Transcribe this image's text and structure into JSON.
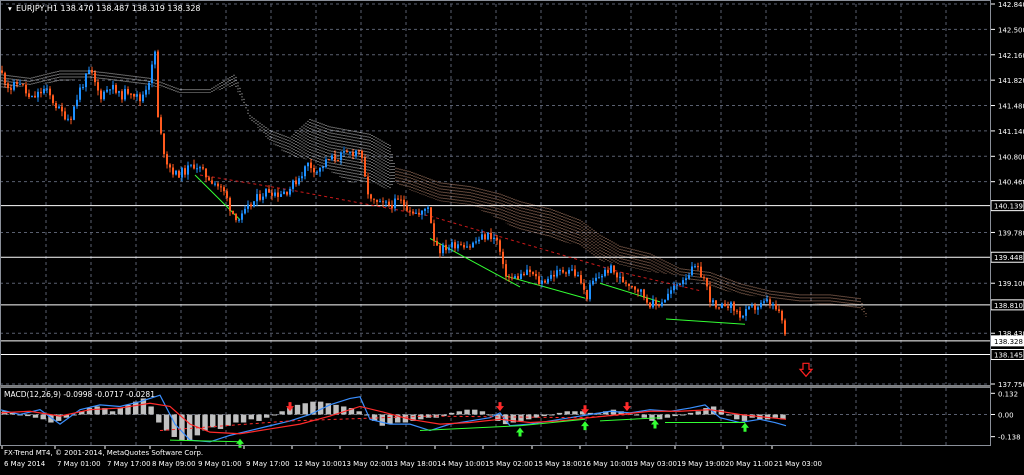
{
  "window": {
    "title": "EURJPY,H1  138.470 138.487 138.319 138.328",
    "copyright": "FX-Trend MT4, © 2001-2014, MetaQuotes Software Corp."
  },
  "colors": {
    "background": "#000000",
    "grid": "#5a6070",
    "bull": "#1e90ff",
    "bear": "#ff5a1e",
    "wick": "#c8c8c8",
    "cloud": "#ffffff",
    "cloud_bear": "#f0b090",
    "trendline": "#33ff33",
    "dashed_line": "#ff2020",
    "level_line": "#ffffff",
    "macd_hist": "#c0c0c0",
    "macd_main": "#3a8fff",
    "macd_signal": "#ff2a2a",
    "arrow_up": "#33ff33",
    "arrow_down": "#ff2a2a",
    "sell_arrow": "#ff2020"
  },
  "chart_data": {
    "type": "candlestick",
    "symbol": "EURJPY",
    "timeframe": "H1",
    "ohlc_header": {
      "open": 138.47,
      "high": 138.487,
      "low": 138.319,
      "close": 138.328
    },
    "y_ticks": [
      "142.840",
      "142.500",
      "142.160",
      "141.820",
      "141.480",
      "141.140",
      "140.800",
      "140.460",
      "139.780",
      "139.100",
      "138.430",
      "137.750"
    ],
    "y_tick_values": [
      142.84,
      142.5,
      142.16,
      141.82,
      141.48,
      141.14,
      140.8,
      140.46,
      139.78,
      139.1,
      138.43,
      137.75
    ],
    "ylim": [
      137.75,
      142.84
    ],
    "x_ticks": [
      "6 May 2014",
      "7 May 01:00",
      "7 May 17:00",
      "8 May 09:00",
      "9 May 01:00",
      "9 May 17:00",
      "12 May 10:00",
      "13 May 02:00",
      "13 May 18:00",
      "14 May 10:00",
      "15 May 02:00",
      "15 May 18:00",
      "16 May 10:00",
      "19 May 03:00",
      "19 May 19:00",
      "20 May 11:00",
      "21 May 03:00"
    ],
    "levels": [
      {
        "label": "140.139",
        "value": 140.139
      },
      {
        "label": "139.448",
        "value": 139.448
      },
      {
        "label": "138.810",
        "value": 138.81
      },
      {
        "label": "138.328",
        "value": 138.328,
        "current": true
      },
      {
        "label": "138.145",
        "value": 138.145
      }
    ],
    "price_path": [
      [
        0,
        141.95
      ],
      [
        10,
        141.7
      ],
      [
        20,
        141.8
      ],
      [
        30,
        141.55
      ],
      [
        45,
        141.7
      ],
      [
        60,
        141.4
      ],
      [
        70,
        141.3
      ],
      [
        80,
        141.7
      ],
      [
        90,
        141.95
      ],
      [
        100,
        141.6
      ],
      [
        110,
        141.75
      ],
      [
        120,
        141.6
      ],
      [
        130,
        141.7
      ],
      [
        140,
        141.55
      ],
      [
        150,
        141.85
      ],
      [
        155,
        142.2
      ],
      [
        158,
        141.3
      ],
      [
        162,
        141.0
      ],
      [
        166,
        140.75
      ],
      [
        175,
        140.55
      ],
      [
        185,
        140.6
      ],
      [
        195,
        140.7
      ],
      [
        205,
        140.55
      ],
      [
        215,
        140.45
      ],
      [
        225,
        140.3
      ],
      [
        232,
        140.05
      ],
      [
        240,
        139.95
      ],
      [
        248,
        140.1
      ],
      [
        258,
        140.25
      ],
      [
        268,
        140.35
      ],
      [
        278,
        140.3
      ],
      [
        288,
        140.35
      ],
      [
        298,
        140.5
      ],
      [
        308,
        140.7
      ],
      [
        318,
        140.6
      ],
      [
        328,
        140.75
      ],
      [
        340,
        140.8
      ],
      [
        352,
        140.85
      ],
      [
        360,
        140.9
      ],
      [
        364,
        140.55
      ],
      [
        370,
        140.2
      ],
      [
        380,
        140.15
      ],
      [
        390,
        140.15
      ],
      [
        400,
        140.2
      ],
      [
        410,
        140.1
      ],
      [
        420,
        140.0
      ],
      [
        428,
        140.15
      ],
      [
        434,
        139.7
      ],
      [
        440,
        139.55
      ],
      [
        450,
        139.6
      ],
      [
        460,
        139.65
      ],
      [
        470,
        139.6
      ],
      [
        480,
        139.7
      ],
      [
        490,
        139.75
      ],
      [
        498,
        139.65
      ],
      [
        503,
        139.3
      ],
      [
        510,
        139.15
      ],
      [
        520,
        139.2
      ],
      [
        530,
        139.25
      ],
      [
        540,
        139.1
      ],
      [
        550,
        139.2
      ],
      [
        560,
        139.25
      ],
      [
        570,
        139.3
      ],
      [
        580,
        139.15
      ],
      [
        586,
        138.9
      ],
      [
        592,
        139.1
      ],
      [
        600,
        139.2
      ],
      [
        610,
        139.3
      ],
      [
        620,
        139.15
      ],
      [
        630,
        139.1
      ],
      [
        640,
        139.0
      ],
      [
        648,
        138.85
      ],
      [
        656,
        138.8
      ],
      [
        665,
        138.9
      ],
      [
        675,
        139.05
      ],
      [
        685,
        139.2
      ],
      [
        695,
        139.3
      ],
      [
        703,
        139.2
      ],
      [
        710,
        138.9
      ],
      [
        718,
        138.7
      ],
      [
        726,
        138.85
      ],
      [
        734,
        138.75
      ],
      [
        742,
        138.65
      ],
      [
        750,
        138.75
      ],
      [
        760,
        138.8
      ],
      [
        768,
        138.85
      ],
      [
        776,
        138.75
      ],
      [
        782,
        138.6
      ],
      [
        786,
        138.33
      ]
    ],
    "cloud_path": [
      [
        0,
        141.9,
        141.7
      ],
      [
        30,
        141.85,
        141.75
      ],
      [
        60,
        141.95,
        141.8
      ],
      [
        90,
        141.95,
        141.85
      ],
      [
        120,
        141.9,
        141.8
      ],
      [
        150,
        141.85,
        141.75
      ],
      [
        180,
        141.7,
        141.65
      ],
      [
        210,
        141.7,
        141.65
      ],
      [
        235,
        141.9,
        141.75
      ],
      [
        250,
        141.35,
        141.3
      ],
      [
        270,
        141.15,
        141.0
      ],
      [
        290,
        141.05,
        140.8
      ],
      [
        310,
        141.3,
        140.75
      ],
      [
        330,
        141.2,
        140.6
      ],
      [
        350,
        141.15,
        140.45
      ],
      [
        370,
        141.1,
        140.45
      ],
      [
        390,
        140.95,
        140.35
      ],
      [
        395,
        140.65,
        140.45
      ],
      [
        410,
        140.6,
        140.35
      ],
      [
        440,
        140.45,
        140.2
      ],
      [
        470,
        140.4,
        140.15
      ],
      [
        500,
        140.3,
        139.95
      ],
      [
        520,
        140.2,
        139.8
      ],
      [
        550,
        140.1,
        139.7
      ],
      [
        580,
        139.95,
        139.6
      ],
      [
        600,
        139.75,
        139.4
      ],
      [
        620,
        139.6,
        139.35
      ],
      [
        650,
        139.5,
        139.25
      ],
      [
        680,
        139.3,
        139.2
      ],
      [
        710,
        139.25,
        139.05
      ],
      [
        740,
        139.1,
        138.95
      ],
      [
        770,
        139.0,
        138.9
      ],
      [
        800,
        138.95,
        138.85
      ],
      [
        830,
        138.95,
        138.8
      ],
      [
        860,
        138.9,
        138.75
      ],
      [
        866,
        138.7,
        138.65
      ]
    ],
    "trendlines": [
      [
        [
          195,
          140.55
        ],
        [
          240,
          139.95
        ]
      ],
      [
        [
          430,
          139.7
        ],
        [
          520,
          139.05
        ]
      ],
      [
        [
          505,
          139.2
        ],
        [
          585,
          138.9
        ]
      ],
      [
        [
          600,
          139.1
        ],
        [
          660,
          138.85
        ]
      ],
      [
        [
          666,
          138.62
        ],
        [
          745,
          138.55
        ]
      ]
    ],
    "dashed_trend": [
      [
        200,
        140.55
      ],
      [
        290,
        140.35
      ],
      [
        430,
        140.0
      ],
      [
        620,
        139.25
      ],
      [
        700,
        139.0
      ]
    ],
    "sell_signal": {
      "x": 806,
      "value": 137.92
    },
    "macd": {
      "label": "MACD(12,26,9) -0.0998 -0.0717 -0.0281",
      "y_ticks": [
        "0.132",
        "0.00",
        "-0.138"
      ],
      "y_tick_values": [
        0.132,
        0.0,
        -0.138
      ],
      "ylim": [
        -0.19,
        0.165
      ],
      "histogram": [
        0.02,
        0.01,
        0.0,
        -0.01,
        -0.02,
        -0.03,
        -0.05,
        -0.04,
        -0.02,
        0.0,
        0.02,
        0.04,
        0.05,
        0.04,
        0.02,
        0.04,
        0.06,
        0.08,
        0.1,
        0.05,
        -0.05,
        -0.1,
        -0.14,
        -0.16,
        -0.16,
        -0.13,
        -0.1,
        -0.08,
        -0.09,
        -0.07,
        -0.05,
        -0.05,
        -0.03,
        -0.04,
        -0.02,
        0.0,
        0.02,
        0.04,
        0.06,
        0.07,
        0.08,
        0.08,
        0.07,
        0.06,
        0.05,
        0.04,
        0.02,
        0.0,
        -0.04,
        -0.07,
        -0.06,
        -0.05,
        -0.05,
        -0.04,
        -0.03,
        -0.02,
        -0.02,
        -0.01,
        0.01,
        0.02,
        0.03,
        0.03,
        0.02,
        0.0,
        -0.04,
        -0.06,
        -0.05,
        -0.04,
        -0.03,
        -0.02,
        -0.01,
        0.0,
        0.01,
        0.02,
        0.02,
        0.02,
        0.01,
        0.01,
        0.02,
        0.03,
        0.02,
        0.01,
        0.0,
        -0.02,
        -0.04,
        -0.03,
        -0.02,
        -0.01,
        0.0,
        0.01,
        0.02,
        0.04,
        0.05,
        0.03,
        0.0,
        -0.03,
        -0.04,
        -0.02,
        -0.03,
        -0.03,
        -0.02,
        -0.03
      ],
      "main_line": [
        [
          0,
          0.03
        ],
        [
          20,
          0.0
        ],
        [
          40,
          0.03
        ],
        [
          60,
          -0.06
        ],
        [
          80,
          0.03
        ],
        [
          100,
          0.06
        ],
        [
          120,
          0.05
        ],
        [
          140,
          0.08
        ],
        [
          160,
          0.12
        ],
        [
          175,
          -0.06
        ],
        [
          190,
          -0.16
        ],
        [
          210,
          -0.17
        ],
        [
          230,
          -0.13
        ],
        [
          250,
          -0.1
        ],
        [
          270,
          -0.07
        ],
        [
          290,
          -0.04
        ],
        [
          310,
          0.0
        ],
        [
          330,
          0.06
        ],
        [
          350,
          0.1
        ],
        [
          360,
          0.11
        ],
        [
          370,
          -0.03
        ],
        [
          390,
          -0.06
        ],
        [
          410,
          -0.06
        ],
        [
          430,
          -0.1
        ],
        [
          450,
          -0.06
        ],
        [
          470,
          -0.04
        ],
        [
          490,
          -0.02
        ],
        [
          500,
          0.01
        ],
        [
          510,
          -0.07
        ],
        [
          530,
          -0.06
        ],
        [
          550,
          -0.04
        ],
        [
          570,
          -0.02
        ],
        [
          590,
          0.0
        ],
        [
          610,
          0.02
        ],
        [
          630,
          0.01
        ],
        [
          650,
          0.03
        ],
        [
          670,
          0.02
        ],
        [
          690,
          0.04
        ],
        [
          705,
          0.06
        ],
        [
          720,
          -0.02
        ],
        [
          740,
          -0.05
        ],
        [
          760,
          -0.03
        ],
        [
          775,
          -0.05
        ],
        [
          786,
          -0.07
        ]
      ],
      "signal_line": [
        [
          0,
          0.01
        ],
        [
          30,
          0.02
        ],
        [
          60,
          -0.01
        ],
        [
          90,
          0.03
        ],
        [
          120,
          0.04
        ],
        [
          150,
          0.07
        ],
        [
          170,
          0.05
        ],
        [
          190,
          -0.06
        ],
        [
          210,
          -0.11
        ],
        [
          240,
          -0.12
        ],
        [
          270,
          -0.09
        ],
        [
          300,
          -0.06
        ],
        [
          330,
          -0.01
        ],
        [
          360,
          0.05
        ],
        [
          380,
          0.02
        ],
        [
          410,
          -0.03
        ],
        [
          440,
          -0.06
        ],
        [
          470,
          -0.05
        ],
        [
          500,
          -0.03
        ],
        [
          530,
          -0.05
        ],
        [
          560,
          -0.04
        ],
        [
          590,
          -0.02
        ],
        [
          620,
          0.0
        ],
        [
          650,
          0.02
        ],
        [
          680,
          0.02
        ],
        [
          710,
          0.03
        ],
        [
          740,
          0.0
        ],
        [
          770,
          -0.02
        ],
        [
          786,
          -0.03
        ]
      ],
      "signal_dashed": [
        [
          160,
          -0.1
        ],
        [
          290,
          -0.04
        ],
        [
          430,
          -0.01
        ],
        [
          580,
          -0.02
        ],
        [
          630,
          0.0
        ]
      ],
      "green_lines": [
        [
          [
            170,
            -0.16
          ],
          [
            240,
            -0.17
          ]
        ],
        [
          [
            420,
            -0.1
          ],
          [
            520,
            -0.07
          ]
        ],
        [
          [
            520,
            -0.07
          ],
          [
            585,
            -0.03
          ]
        ],
        [
          [
            600,
            -0.04
          ],
          [
            660,
            -0.02
          ]
        ],
        [
          [
            665,
            -0.05
          ],
          [
            745,
            -0.05
          ]
        ]
      ],
      "arrows_up": [
        [
          240,
          -0.17
        ],
        [
          520,
          -0.1
        ],
        [
          585,
          -0.06
        ],
        [
          655,
          -0.05
        ],
        [
          745,
          -0.07
        ]
      ],
      "arrows_down": [
        [
          290,
          0.04
        ],
        [
          500,
          0.04
        ],
        [
          585,
          0.02
        ],
        [
          627,
          0.04
        ]
      ]
    }
  }
}
